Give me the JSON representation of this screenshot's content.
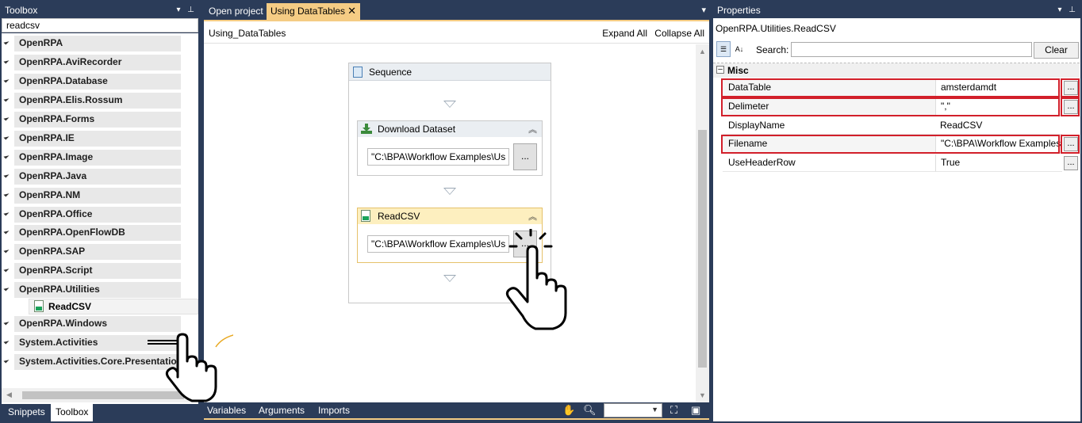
{
  "toolbox": {
    "title": "Toolbox",
    "search_value": "readcsv",
    "items": [
      {
        "label": "OpenRPA"
      },
      {
        "label": "OpenRPA.AviRecorder"
      },
      {
        "label": "OpenRPA.Database"
      },
      {
        "label": "OpenRPA.Elis.Rossum"
      },
      {
        "label": "OpenRPA.Forms"
      },
      {
        "label": "OpenRPA.IE"
      },
      {
        "label": "OpenRPA.Image"
      },
      {
        "label": "OpenRPA.Java"
      },
      {
        "label": "OpenRPA.NM"
      },
      {
        "label": "OpenRPA.Office"
      },
      {
        "label": "OpenRPA.OpenFlowDB"
      },
      {
        "label": "OpenRPA.SAP"
      },
      {
        "label": "OpenRPA.Script"
      },
      {
        "label": "OpenRPA.Utilities"
      },
      {
        "label": "OpenRPA.Windows"
      },
      {
        "label": "System.Activities"
      },
      {
        "label": "System.Activities.Core.Presentation"
      }
    ],
    "sub_item": "ReadCSV",
    "bottom_tabs": [
      "Snippets",
      "Toolbox"
    ]
  },
  "designer": {
    "tabs": [
      "Open project",
      "Using DataTables"
    ],
    "close_glyph": "✕",
    "breadcrumb": "Using_DataTables",
    "expand_all": "Expand All",
    "collapse_all": "Collapse All",
    "sequence_title": "Sequence",
    "activities": [
      {
        "title": "Download Dataset",
        "input_value": "\"C:\\BPA\\Workflow Examples\\Us",
        "button": "..."
      },
      {
        "title": "ReadCSV",
        "input_value": "\"C:\\BPA\\Workflow Examples\\Us",
        "button": "..."
      }
    ],
    "footer_tabs": [
      "Variables",
      "Arguments",
      "Imports"
    ],
    "zoom_value": ""
  },
  "properties": {
    "title": "Properties",
    "type_name": "OpenRPA.Utilities.ReadCSV",
    "search_label": "Search:",
    "search_value": "",
    "clear_label": "Clear",
    "category": "Misc",
    "rows": [
      {
        "name": "DataTable",
        "value": "amsterdamdt",
        "button": "...",
        "highlighted": true
      },
      {
        "name": "Delimeter",
        "value": "\",\"",
        "button": "...",
        "highlighted": true
      },
      {
        "name": "DisplayName",
        "value": "ReadCSV",
        "button": "",
        "highlighted": false
      },
      {
        "name": "Filename",
        "value": "\"C:\\BPA\\Workflow Examples",
        "button": "...",
        "highlighted": true
      },
      {
        "name": "UseHeaderRow",
        "value": "True",
        "button": "...",
        "highlighted": false
      }
    ]
  },
  "colors": {
    "chrome": "#2b3c59",
    "accent": "#f5cc84",
    "highlight": "#d21f2a"
  },
  "icons": [
    "pin-icon",
    "dropdown-icon",
    "sequence-icon",
    "download-icon",
    "csv-file-icon",
    "hand-pointer-icon",
    "zoom-icon",
    "fit-icon",
    "overview-icon",
    "categorized-icon",
    "alphabetical-icon"
  ]
}
